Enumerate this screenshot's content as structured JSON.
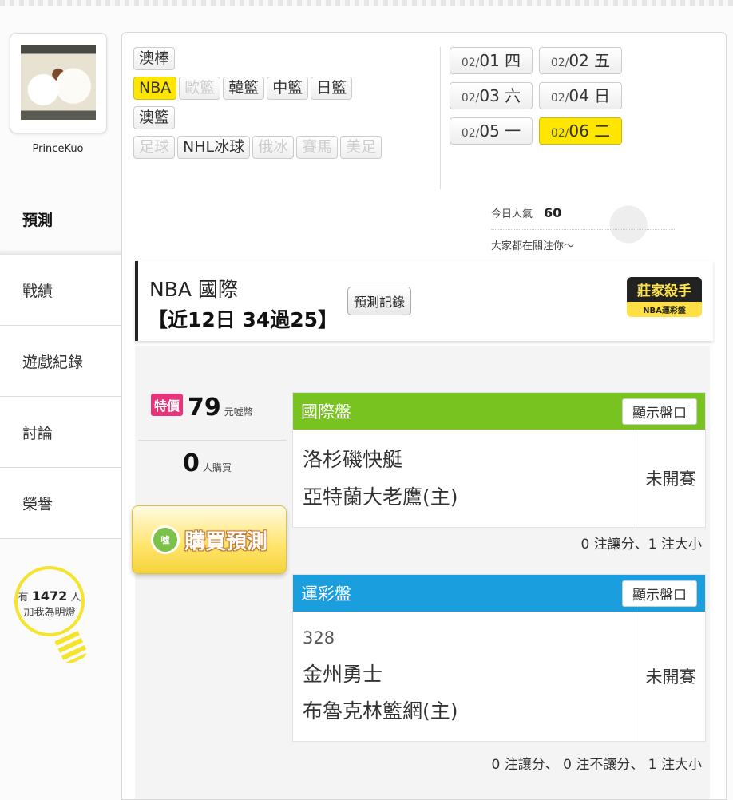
{
  "profile": {
    "username": "PrinceKuo"
  },
  "nav": [
    {
      "label": "預測",
      "active": true
    },
    {
      "label": "戰績",
      "active": false
    },
    {
      "label": "遊戲紀錄",
      "active": false
    },
    {
      "label": "討論",
      "active": false
    },
    {
      "label": "榮譽",
      "active": false
    }
  ],
  "lamp": {
    "prefix": "有",
    "count": "1472",
    "suffix": "人",
    "sub": "加我為明燈"
  },
  "sports": [
    {
      "label": "澳棒",
      "state": "normal"
    },
    {
      "label": "NBA",
      "state": "active"
    },
    {
      "label": "歐籃",
      "state": "disabled"
    },
    {
      "label": "韓籃",
      "state": "normal"
    },
    {
      "label": "中籃",
      "state": "normal"
    },
    {
      "label": "日籃",
      "state": "normal"
    },
    {
      "label": "澳籃",
      "state": "normal"
    },
    {
      "label": "足球",
      "state": "disabled"
    },
    {
      "label": "NHL冰球",
      "state": "normal"
    },
    {
      "label": "俄冰",
      "state": "disabled"
    },
    {
      "label": "賽馬",
      "state": "disabled"
    },
    {
      "label": "美足",
      "state": "disabled"
    }
  ],
  "dates": [
    {
      "month": "02/",
      "day": "01",
      "weekday": "四",
      "active": false
    },
    {
      "month": "02/",
      "day": "02",
      "weekday": "五",
      "active": false
    },
    {
      "month": "02/",
      "day": "03",
      "weekday": "六",
      "active": false
    },
    {
      "month": "02/",
      "day": "04",
      "weekday": "日",
      "active": false
    },
    {
      "month": "02/",
      "day": "05",
      "weekday": "一",
      "active": false
    },
    {
      "month": "02/",
      "day": "06",
      "weekday": "二",
      "active": true
    }
  ],
  "popularity": {
    "label": "今日人氣",
    "value": "60",
    "sub": "大家都在關注你～"
  },
  "header": {
    "league": "NBA 國際",
    "record": "【近12日 34過25】",
    "record_button": "預測記錄",
    "badge_top": "莊家殺手",
    "badge_bottom": "NBA運彩盤"
  },
  "purchase": {
    "tag": "特價",
    "price": "79",
    "price_unit": "元噓幣",
    "buyers": "0",
    "buyers_unit": "人購買",
    "coin": "噓",
    "buy_label": "購買預測"
  },
  "markets": {
    "intl": {
      "title": "國際盤",
      "show_button": "顯示盤口",
      "color": "#78c320",
      "teams": [
        "洛杉磯快艇",
        "亞特蘭大老鷹(主)"
      ],
      "status": "未開賽",
      "summary": "0 注讓分、1 注大小"
    },
    "lottery": {
      "title": "運彩盤",
      "show_button": "顯示盤口",
      "color": "#1a9ede",
      "game_no": "328",
      "teams": [
        "金州勇士",
        "布魯克林籃網(主)"
      ],
      "status": "未開賽",
      "summary": "0 注讓分、 0 注不讓分、 1 注大小"
    }
  }
}
